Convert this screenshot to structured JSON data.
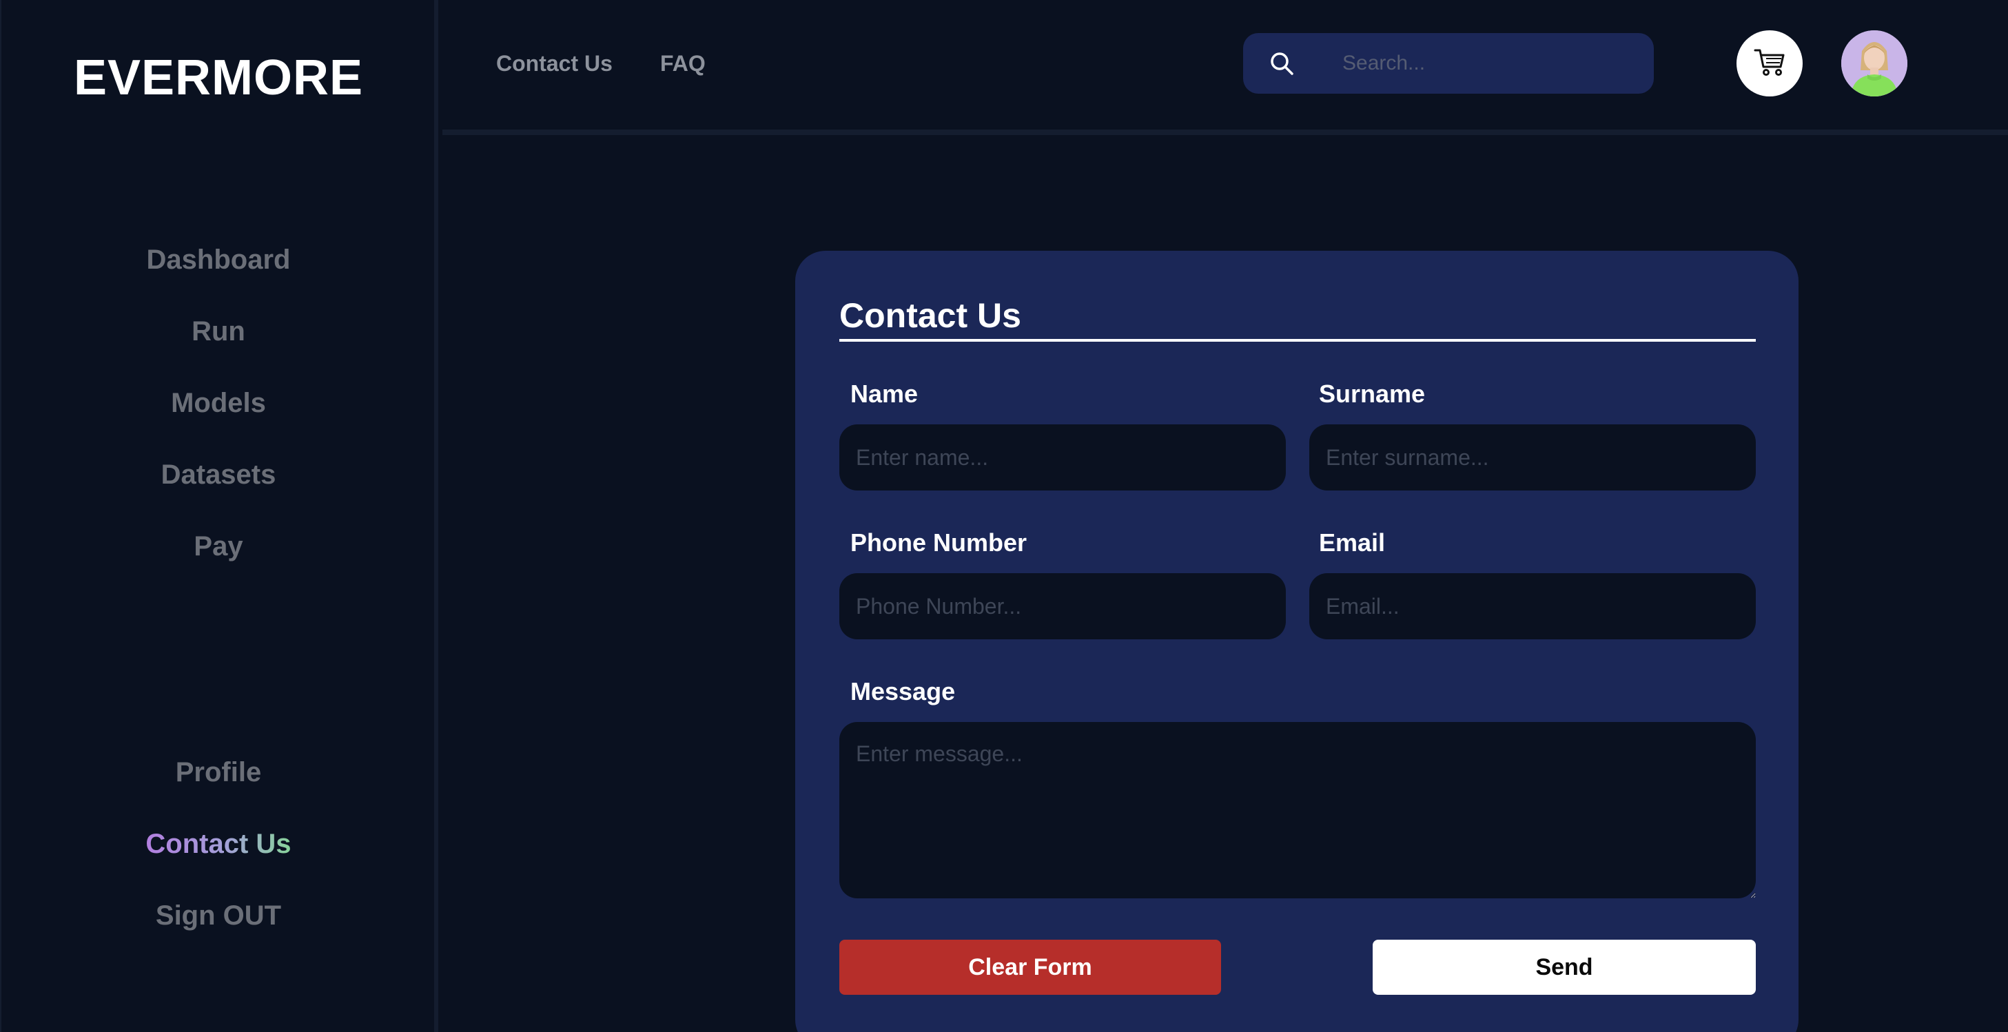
{
  "brand": {
    "name": "EVERMORE"
  },
  "sidebar": {
    "main_items": [
      {
        "label": "Dashboard"
      },
      {
        "label": "Run"
      },
      {
        "label": "Models"
      },
      {
        "label": "Datasets"
      },
      {
        "label": "Pay"
      }
    ],
    "bottom_items": [
      {
        "label": "Profile",
        "active": false
      },
      {
        "label": "Contact Us",
        "active": true
      },
      {
        "label": "Sign OUT",
        "active": false
      }
    ]
  },
  "header": {
    "links": [
      {
        "label": "Contact Us"
      },
      {
        "label": "FAQ"
      }
    ],
    "search": {
      "placeholder": "Search...",
      "value": ""
    },
    "icons": {
      "search": "search-icon",
      "cart": "cart-icon",
      "avatar": "user-avatar"
    }
  },
  "contact_form": {
    "title": "Contact Us",
    "name": {
      "label": "Name",
      "placeholder": "Enter name..."
    },
    "surname": {
      "label": "Surname",
      "placeholder": "Enter surname..."
    },
    "phone": {
      "label": "Phone Number",
      "placeholder": "Phone Number..."
    },
    "email": {
      "label": "Email",
      "placeholder": "Email..."
    },
    "message": {
      "label": "Message",
      "placeholder": "Enter message..."
    },
    "clear_label": "Clear Form",
    "send_label": "Send"
  },
  "colors": {
    "background": "#0a1120",
    "card": "#1b2757",
    "clear_button": "#b62e2a",
    "send_button": "#ffffff",
    "active_gradient_start": "#b27fe0",
    "active_gradient_end": "#88d49a"
  }
}
